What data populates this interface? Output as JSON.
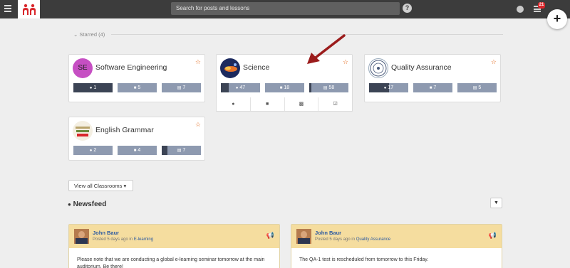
{
  "topbar": {
    "search_placeholder": "Search for posts and lessons",
    "help_label": "?",
    "notification_count": "21",
    "add_label": "+"
  },
  "starred": {
    "label": "Starred (4)"
  },
  "classrooms": [
    {
      "name": "Software Engineering",
      "avatar_text": "SE",
      "avatar_color": "#c64fc3",
      "stats": {
        "posts": "1",
        "lessons": "5",
        "items": "7"
      },
      "stat_fill": [
        1,
        0,
        0
      ]
    },
    {
      "name": "Science",
      "stats": {
        "posts": "47",
        "lessons": "18",
        "items": "58"
      },
      "stat_fill": [
        0.2,
        0,
        0.05
      ]
    },
    {
      "name": "Quality Assurance",
      "stats": {
        "posts": "17",
        "lessons": "7",
        "items": "5"
      },
      "stat_fill": [
        0.5,
        0,
        0
      ]
    },
    {
      "name": "English Grammar",
      "stats": {
        "posts": "2",
        "lessons": "4",
        "items": "7"
      },
      "stat_fill": [
        0,
        0,
        0.15
      ]
    }
  ],
  "view_all_label": "View all Classrooms",
  "newsfeed": {
    "title": "Newsfeed",
    "posts": [
      {
        "author": "John Baur",
        "meta_prefix": "Posted 5 days ago in",
        "classroom": "E-learning",
        "body": "Please note that we are conducting a global e-learning seminar tomorrow at the main auditorium. Be there!"
      },
      {
        "author": "John Baur",
        "meta_prefix": "Posted 5 days ago in",
        "classroom": "Quality Assurance",
        "body": "The QA-1 test is rescheduled from tomorrow to this Friday."
      }
    ]
  },
  "colors": {
    "topbar": "#3c3c3c",
    "accent_red": "#d9262b",
    "arrow": "#9b1c1c",
    "stat_bar": "#8e9ab0",
    "stat_fill": "#3c4455",
    "post_header": "#f5dd9f"
  }
}
